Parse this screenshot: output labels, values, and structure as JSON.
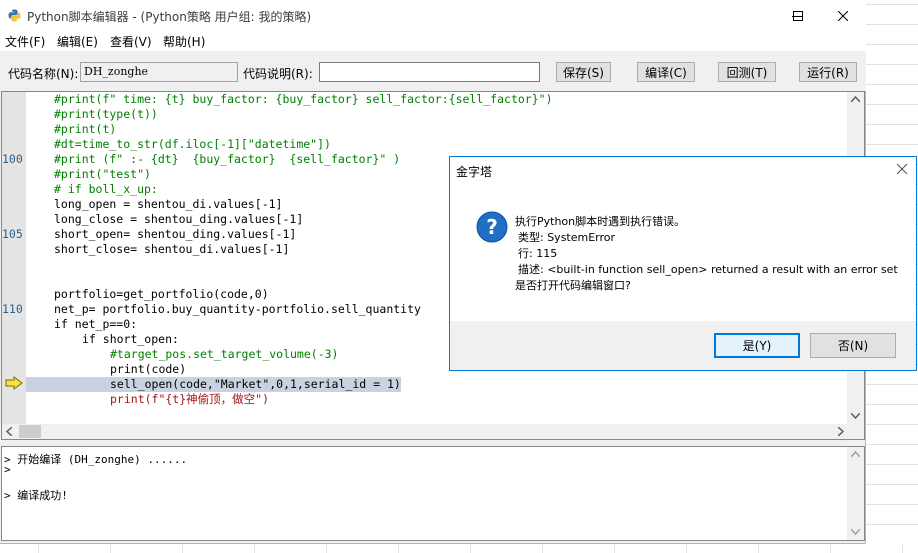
{
  "window": {
    "title": "Python脚本编辑器 - (Python策略 用户组: 我的策略)"
  },
  "menu": [
    "文件(F)",
    "编辑(E)",
    "查看(V)",
    "帮助(H)"
  ],
  "toolbar": {
    "code_name_label": "代码名称(N):",
    "code_name_value": "DH_zonghe",
    "desc_label": "代码说明(R):",
    "desc_value": "",
    "save": "保存(S)",
    "compile": "编译(C)",
    "backtest": "回测(T)",
    "run": "运行(R)"
  },
  "editor": {
    "line_numbers": [
      {
        "num": "100",
        "row": 4
      },
      {
        "num": "105",
        "row": 9
      },
      {
        "num": "110",
        "row": 14
      }
    ],
    "lines": [
      {
        "text": "#print(f\" time: {t} buy_factor: {buy_factor} sell_factor:{sell_factor}\")",
        "style": "c-green",
        "indent": 4
      },
      {
        "text": "#print(type(t))",
        "style": "c-green",
        "indent": 4
      },
      {
        "text": "#print(t)",
        "style": "c-green",
        "indent": 4
      },
      {
        "text": "#dt=time_to_str(df.iloc[-1][\"datetime\"])",
        "style": "c-green",
        "indent": 4
      },
      {
        "text": "#print (f\" :- {dt}  {buy_factor}  {sell_factor}\" )",
        "style": "c-green",
        "indent": 4
      },
      {
        "text": "#print(\"test\")",
        "style": "c-green",
        "indent": 4
      },
      {
        "text": "# if boll_x_up:",
        "style": "c-green",
        "indent": 4
      },
      {
        "text": "long_open = shentou_di.values[-1]",
        "style": "c-black",
        "indent": 4
      },
      {
        "text": "long_close = shentou_ding.values[-1]",
        "style": "c-black",
        "indent": 4
      },
      {
        "text": "short_open= shentou_ding.values[-1]",
        "style": "c-black",
        "indent": 4
      },
      {
        "text": "short_close= shentou_di.values[-1]",
        "style": "c-black",
        "indent": 4
      },
      {
        "text": "",
        "style": "c-black",
        "indent": 4
      },
      {
        "text": "",
        "style": "c-black",
        "indent": 4
      },
      {
        "text": "portfolio=get_portfolio(code,0)",
        "style": "c-black",
        "indent": 4
      },
      {
        "text": "net_p= portfolio.buy_quantity-portfolio.sell_quantity",
        "style": "c-black",
        "indent": 4
      },
      {
        "text": "if net_p==0:",
        "style": "c-black",
        "indent": 4
      },
      {
        "text": "if short_open:",
        "style": "c-black",
        "indent": 8
      },
      {
        "text": "#target_pos.set_target_volume(-3)",
        "style": "c-green",
        "indent": 12
      },
      {
        "text": "print(code)",
        "style": "c-black",
        "indent": 12
      },
      {
        "text": "sell_open(code,\"Market\",0,1,serial_id = 1)",
        "style": "c-black",
        "indent": 12,
        "current": true
      },
      {
        "text": "print(f\"{t}神偷顶，做空\")",
        "style": "c-red",
        "indent": 12
      }
    ]
  },
  "output": {
    "lines": [
      "> 开始编译 (DH_zonghe) ......",
      ">",
      "",
      "> 编译成功!"
    ]
  },
  "dialog": {
    "title": "金字塔",
    "message": [
      "执行Python脚本时遇到执行错误。",
      "类型: SystemError",
      "行: 115",
      "描述: <built-in function sell_open> returned a result with an error set",
      "是否打开代码编辑窗口?"
    ],
    "yes": "是(Y)",
    "no": "否(N)"
  },
  "icons": {
    "app": "python-icon",
    "question": "question-icon",
    "current_line": "current-line-arrow-icon"
  },
  "colors": {
    "accent": "#0078d7",
    "comment": "#008000",
    "string": "#a31515",
    "line_number": "#2b5f8c"
  }
}
